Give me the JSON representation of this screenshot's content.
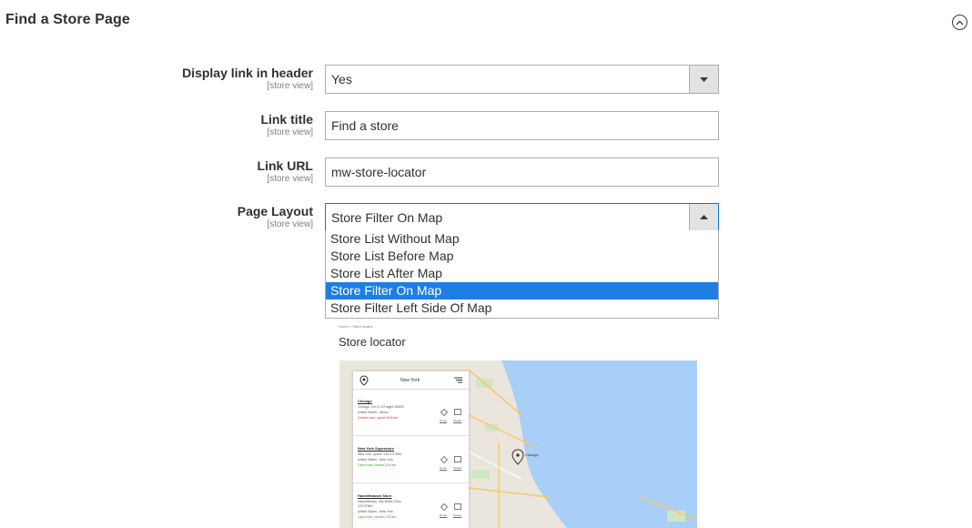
{
  "section": {
    "title": "Find a Store Page",
    "collapse_icon": "chevron-up-icon"
  },
  "fields": [
    {
      "label": "Display link in header",
      "scope": "[store view]",
      "type": "select",
      "value": "Yes"
    },
    {
      "label": "Link title",
      "scope": "[store view]",
      "type": "text",
      "value": "Find a store"
    },
    {
      "label": "Link URL",
      "scope": "[store view]",
      "type": "text",
      "value": "mw-store-locator"
    },
    {
      "label": "Page Layout",
      "scope": "[store view]",
      "type": "select",
      "value": "Store Filter On Map"
    }
  ],
  "layout_options": [
    "Store List Without Map",
    "Store List Before Map",
    "Store List After Map",
    "Store Filter On Map",
    "Store Filter Left Side Of Map"
  ],
  "selected_layout_index": 3,
  "preview": {
    "breadcrumb": "Home  >  Store locator",
    "title": "Store locator",
    "search_city": "New York",
    "map_marker_label": "Chicago",
    "stores": [
      {
        "name": "Chicago",
        "address": "Chicago, Chi d 123 rage2 60606",
        "country": "United States , Illinois",
        "status": "Closed now / opens 8:00 am",
        "open": false
      },
      {
        "name": "New York Superstore",
        "address": "New York, Queen 133-3 07084",
        "country": "United States , New York",
        "status": "Open now / closes 1:00 am",
        "open": true
      },
      {
        "name": "Hackettstown Store",
        "address": "Hackettstown, 46c Beltre Town",
        "address2": "123 07840",
        "country": "United States , New York",
        "status": "Open now / closes 1:00 am",
        "open": true
      }
    ],
    "route_label": "Route",
    "details_label": "Details"
  },
  "colors": {
    "selected_option_bg": "#1e7ee4",
    "lake": "#a8cff7",
    "land": "#eae6dd"
  }
}
